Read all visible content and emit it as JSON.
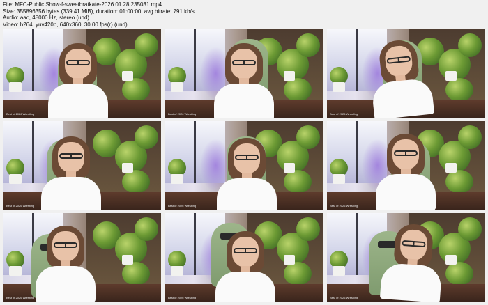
{
  "header": {
    "file": "File: MFC-Public.Show-f-sweetbratkate-2026.01.28.235031.mp4",
    "size": "Size: 355896356 bytes (339.41 MiB), duration: 01:00:00, avg.bitrate: 791 kb/s",
    "audio": "Audio: aac, 48000 Hz, stereo (und)",
    "video": "Video: h264, yuv420p, 640x360, 30.00 fps(r) (und)"
  },
  "thumbnails": [
    {
      "name": "frame-1",
      "watermark": "Best of 2026 Wrestling"
    },
    {
      "name": "frame-2",
      "watermark": "Best of 2026 Wrestling"
    },
    {
      "name": "frame-3",
      "watermark": "Best of 2026 Wrestling"
    },
    {
      "name": "frame-4",
      "watermark": "Best of 2026 Wrestling"
    },
    {
      "name": "frame-5",
      "watermark": "Best of 2026 Wrestling"
    },
    {
      "name": "frame-6",
      "watermark": "Best of 2026 Wrestling"
    },
    {
      "name": "frame-7",
      "watermark": "Best of 2026 Wrestling"
    },
    {
      "name": "frame-8",
      "watermark": "Best of 2026 Wrestling"
    },
    {
      "name": "frame-9",
      "watermark": "Best of 2026 Wrestling"
    }
  ],
  "colors": {
    "background": "#f0f0f0",
    "shirt": "#fafafa",
    "chair": "#9db58a",
    "hair": "#6b4a35"
  }
}
